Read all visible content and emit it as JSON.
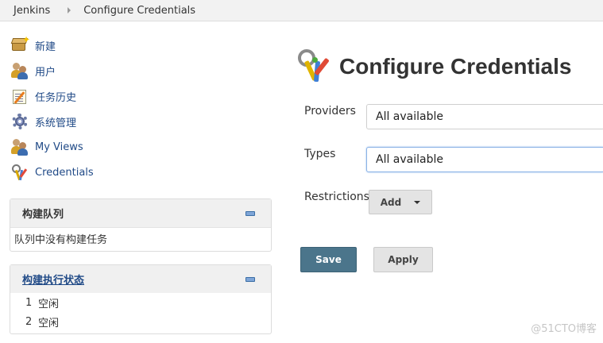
{
  "breadcrumb": {
    "items": [
      "Jenkins",
      "Configure Credentials"
    ]
  },
  "sidebar": {
    "tasks": [
      {
        "label": "新建",
        "icon": "new-item-icon"
      },
      {
        "label": "用户",
        "icon": "users-icon"
      },
      {
        "label": "任务历史",
        "icon": "build-history-icon"
      },
      {
        "label": "系统管理",
        "icon": "manage-gear-icon"
      },
      {
        "label": "My Views",
        "icon": "users-icon"
      },
      {
        "label": "Credentials",
        "icon": "credentials-keys-icon"
      }
    ]
  },
  "build_queue": {
    "title": "构建队列",
    "empty_text": "队列中没有构建任务"
  },
  "executor_status": {
    "title": "构建执行状态",
    "rows": [
      {
        "num": "1",
        "status": "空闲"
      },
      {
        "num": "2",
        "status": "空闲"
      }
    ]
  },
  "main": {
    "title": "Configure Credentials",
    "fields": {
      "providers_label": "Providers",
      "providers_value": "All available",
      "types_label": "Types",
      "types_value": "All available",
      "restrictions_label": "Restrictions",
      "add_label": "Add"
    },
    "save_label": "Save",
    "apply_label": "Apply"
  },
  "watermark": "@51CTO博客"
}
